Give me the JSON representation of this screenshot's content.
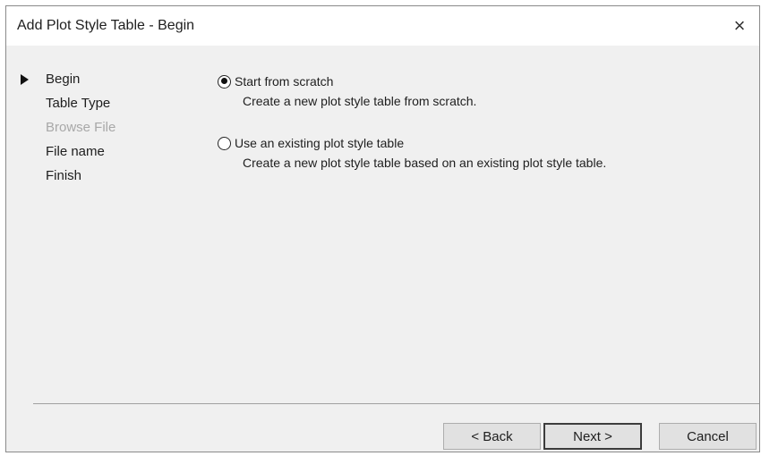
{
  "window": {
    "title": "Add Plot Style Table - Begin",
    "close_label": "×"
  },
  "steps": [
    {
      "label": "Begin",
      "active": true
    },
    {
      "label": "Table Type"
    },
    {
      "label": "Browse File",
      "disabled": true
    },
    {
      "label": "File name"
    },
    {
      "label": "Finish"
    }
  ],
  "options": {
    "scratch": {
      "label": "Start from scratch",
      "description": "Create a new plot style table from scratch.",
      "selected": true
    },
    "existing": {
      "label": "Use an existing plot style table",
      "description": "Create a new plot style table based on an existing plot style table.",
      "selected": false
    }
  },
  "buttons": {
    "back": "< Back",
    "next": "Next >",
    "cancel": "Cancel"
  }
}
